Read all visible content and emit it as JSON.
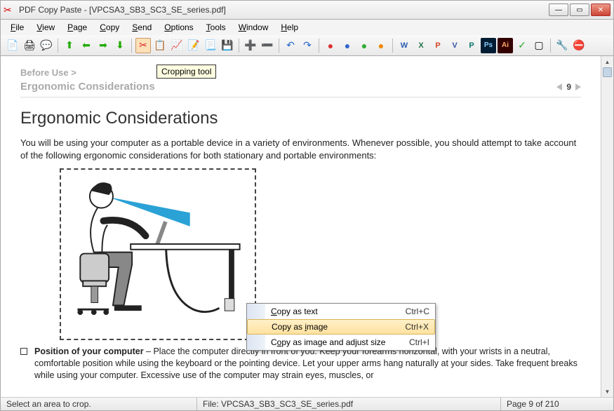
{
  "window": {
    "title": "PDF Copy Paste - [VPCSA3_SB3_SC3_SE_series.pdf]"
  },
  "menus": {
    "file": "File",
    "view": "View",
    "page": "Page",
    "copy": "Copy",
    "send": "Send",
    "options": "Options",
    "tools": "Tools",
    "window": "Window",
    "help": "Help"
  },
  "tooltip": "Cropping tool",
  "doc": {
    "crumb": "Before Use >",
    "section": "Ergonomic Considerations",
    "h1": "Ergonomic Considerations",
    "intro": "You will be using your computer as a portable device in a variety of environments. Whenever possible, you should attempt to take account of the following ergonomic considerations for both stationary and portable environments:",
    "bullet_title": "Position of your computer",
    "bullet_text": " – Place the computer directly in front of you. Keep your forearms horizontal, with your wrists in a neutral, comfortable position while using the keyboard or the pointing device. Let your upper arms hang naturally at your sides. Take frequent breaks while using your computer. Excessive use of the computer may strain eyes, muscles, or",
    "page_number": "9"
  },
  "context_menu": {
    "items": [
      {
        "label": "Copy as text",
        "shortcut": "Ctrl+C"
      },
      {
        "label": "Copy as image",
        "shortcut": "Ctrl+X"
      },
      {
        "label": "Copy as image and adjust size",
        "shortcut": "Ctrl+I"
      }
    ],
    "highlighted": 1
  },
  "status": {
    "hint": "Select an area to crop.",
    "file_label": "File: VPCSA3_SB3_SC3_SE_series.pdf",
    "page": "Page 9 of 210"
  }
}
